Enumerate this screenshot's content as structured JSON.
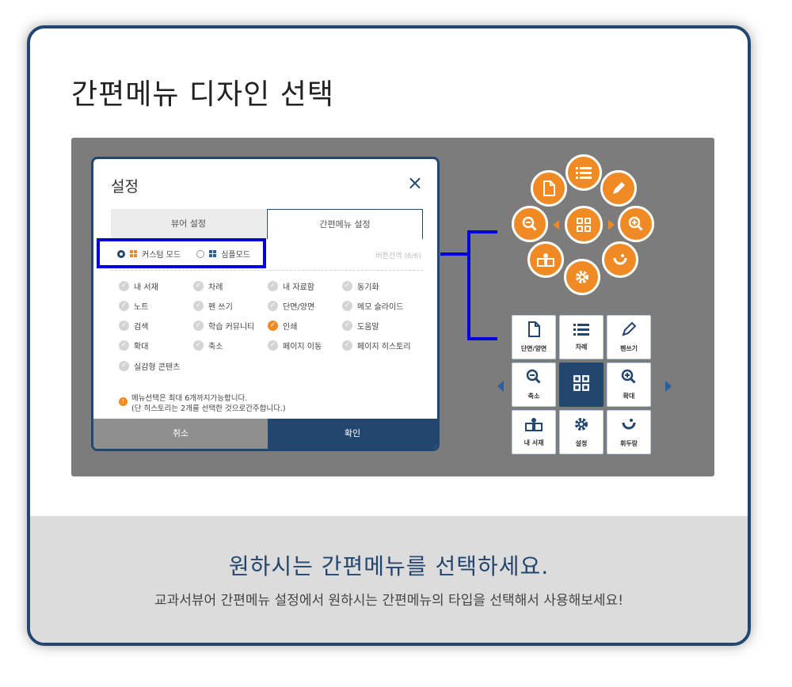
{
  "title": "간편메뉴 디자인 선택",
  "dialog": {
    "title": "설정",
    "close_icon": "×",
    "tabs": [
      "뷰어 설정",
      "간편메뉴 설정"
    ],
    "modes": {
      "custom": "커스텀 모드",
      "simple": "심플모드"
    },
    "faint_text": "버튼간격 (6/6)",
    "items": [
      {
        "label": "내 서재",
        "checked": false
      },
      {
        "label": "차례",
        "checked": false
      },
      {
        "label": "내 자료함",
        "checked": false
      },
      {
        "label": "동기화",
        "checked": false
      },
      {
        "label": "노트",
        "checked": false
      },
      {
        "label": "펜 쓰기",
        "checked": false
      },
      {
        "label": "단면/양면",
        "checked": false
      },
      {
        "label": "메모 슬라이드",
        "checked": false
      },
      {
        "label": "검색",
        "checked": false
      },
      {
        "label": "학습 커뮤니티",
        "checked": false
      },
      {
        "label": "인쇄",
        "checked": true
      },
      {
        "label": "도움말",
        "checked": false
      },
      {
        "label": "확대",
        "checked": false
      },
      {
        "label": "축소",
        "checked": false
      },
      {
        "label": "페이지 이동",
        "checked": false
      },
      {
        "label": "페이지 히스토리",
        "checked": false
      },
      {
        "label": "실감형 콘텐츠",
        "checked": false
      }
    ],
    "note_line1": "메뉴선택은 최대 6개까지가능합니다.",
    "note_line2": "(단 히스토리는 2개를 선택한 것으로간주합니다.)",
    "cancel": "취소",
    "confirm": "확인"
  },
  "grid_menu": {
    "cells": [
      {
        "label": "단면/양면",
        "icon": "page-icon"
      },
      {
        "label": "차례",
        "icon": "list-icon"
      },
      {
        "label": "펜쓰기",
        "icon": "pen-icon"
      },
      {
        "label": "축소",
        "icon": "zoom-out-icon"
      },
      {
        "label": "",
        "icon": "grid-icon"
      },
      {
        "label": "확대",
        "icon": "zoom-in-icon"
      },
      {
        "label": "내 서재",
        "icon": "book-icon"
      },
      {
        "label": "설정",
        "icon": "gear-icon"
      },
      {
        "label": "휘두랑",
        "icon": "logo-icon"
      }
    ]
  },
  "colors": {
    "navy": "#23466f",
    "orange": "#f08a24",
    "highlight": "#0000dd",
    "gray": "#7c7c7c"
  },
  "bottom": {
    "title": "원하시는 간편메뉴를 선택하세요.",
    "subtitle": "교과서뷰어 간편메뉴 설정에서 원하시는 간편메뉴의 타입을 선택해서 사용해보세요!"
  }
}
